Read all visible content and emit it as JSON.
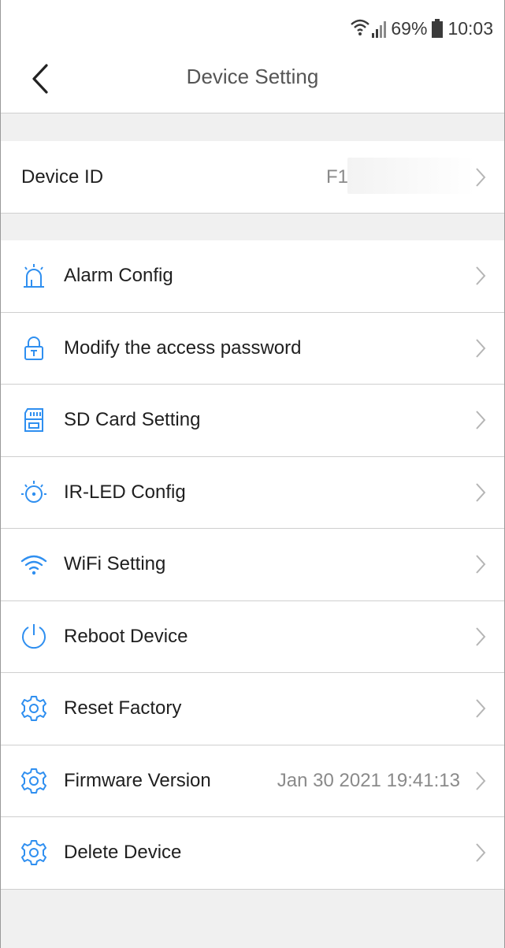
{
  "status": {
    "battery": "69%",
    "time": "10:03"
  },
  "header": {
    "title": "Device Setting"
  },
  "device": {
    "label": "Device ID",
    "value": "F1‹"
  },
  "menu": [
    {
      "label": "Alarm Config",
      "icon": "alarm-icon",
      "value": ""
    },
    {
      "label": "Modify the access password",
      "icon": "lock-icon",
      "value": ""
    },
    {
      "label": "SD Card Setting",
      "icon": "sd-card-icon",
      "value": ""
    },
    {
      "label": "IR-LED Config",
      "icon": "ir-led-icon",
      "value": ""
    },
    {
      "label": "WiFi Setting",
      "icon": "wifi-icon",
      "value": ""
    },
    {
      "label": "Reboot Device",
      "icon": "power-icon",
      "value": ""
    },
    {
      "label": "Reset Factory",
      "icon": "gear-icon",
      "value": ""
    },
    {
      "label": "Firmware Version",
      "icon": "gear-icon",
      "value": "Jan 30 2021 19:41:13"
    },
    {
      "label": "Delete Device",
      "icon": "gear-icon",
      "value": ""
    }
  ],
  "colors": {
    "accent": "#2f8ff0",
    "chevron": "#b5b5b5"
  }
}
